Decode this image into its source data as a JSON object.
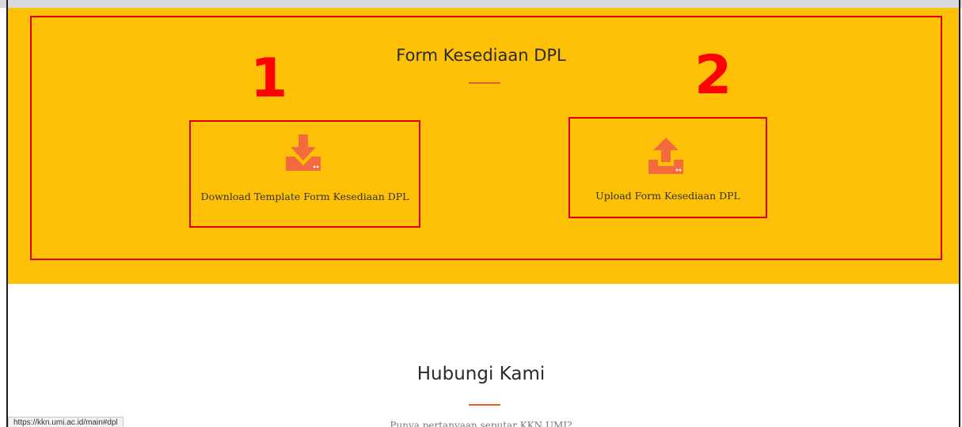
{
  "form_section": {
    "title": "Form Kesediaan DPL",
    "background": "#ffc107",
    "accent": "#e55e2b",
    "icon_color": "#f26a3d",
    "cards": [
      {
        "label": "Download Template Form Kesediaan DPL",
        "icon": "download-tray-icon"
      },
      {
        "label": "Upload Form Kesediaan DPL",
        "icon": "upload-tray-icon"
      }
    ]
  },
  "annotations": {
    "color": "#ff0000",
    "marker_1": "1",
    "marker_2": "2"
  },
  "contact_section": {
    "title": "Hubungi Kami",
    "subtitle": "Punya pertanyaan seputar KKN UMI?"
  },
  "status_bar": {
    "url": "https://kkn.umi.ac.id/main#dpl"
  }
}
